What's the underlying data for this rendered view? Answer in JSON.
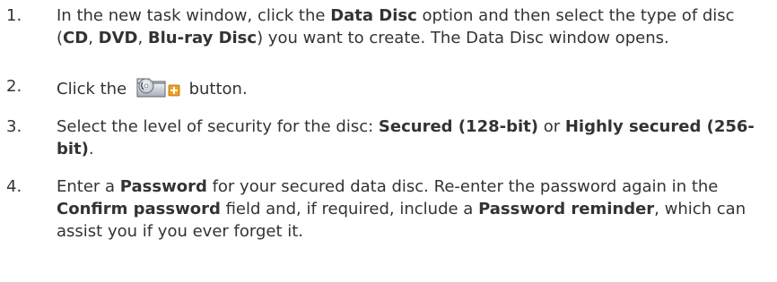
{
  "steps": [
    {
      "number": "1.",
      "parts": {
        "a": "In the new task window, click the ",
        "b": "Data Disc",
        "c": " option and then select the type of disc (",
        "d": "CD",
        "e": ", ",
        "f": "DVD",
        "g": ", ",
        "h": "Blu-ray Disc",
        "i": ") you want to create. The Data Disc window opens."
      }
    },
    {
      "number": "2.",
      "parts": {
        "a": "Click the ",
        "b": " button."
      },
      "icon": "add-secured-disc-icon"
    },
    {
      "number": "3.",
      "parts": {
        "a": "Select the level of security for the disc: ",
        "b": "Secured (128-bit)",
        "c": " or ",
        "d": "Highly secured (256-bit)",
        "e": "."
      }
    },
    {
      "number": "4.",
      "parts": {
        "a": "Enter a ",
        "b": "Password",
        "c": " for your secured data disc. Re-enter the password again in the ",
        "d": "Confirm password",
        "e": " field and, if required, include a ",
        "f": "Password reminder",
        "g": ", which can assist you if you ever forget it."
      }
    }
  ],
  "colors": {
    "text": "#333333",
    "icon_plus": "#f0a020"
  }
}
